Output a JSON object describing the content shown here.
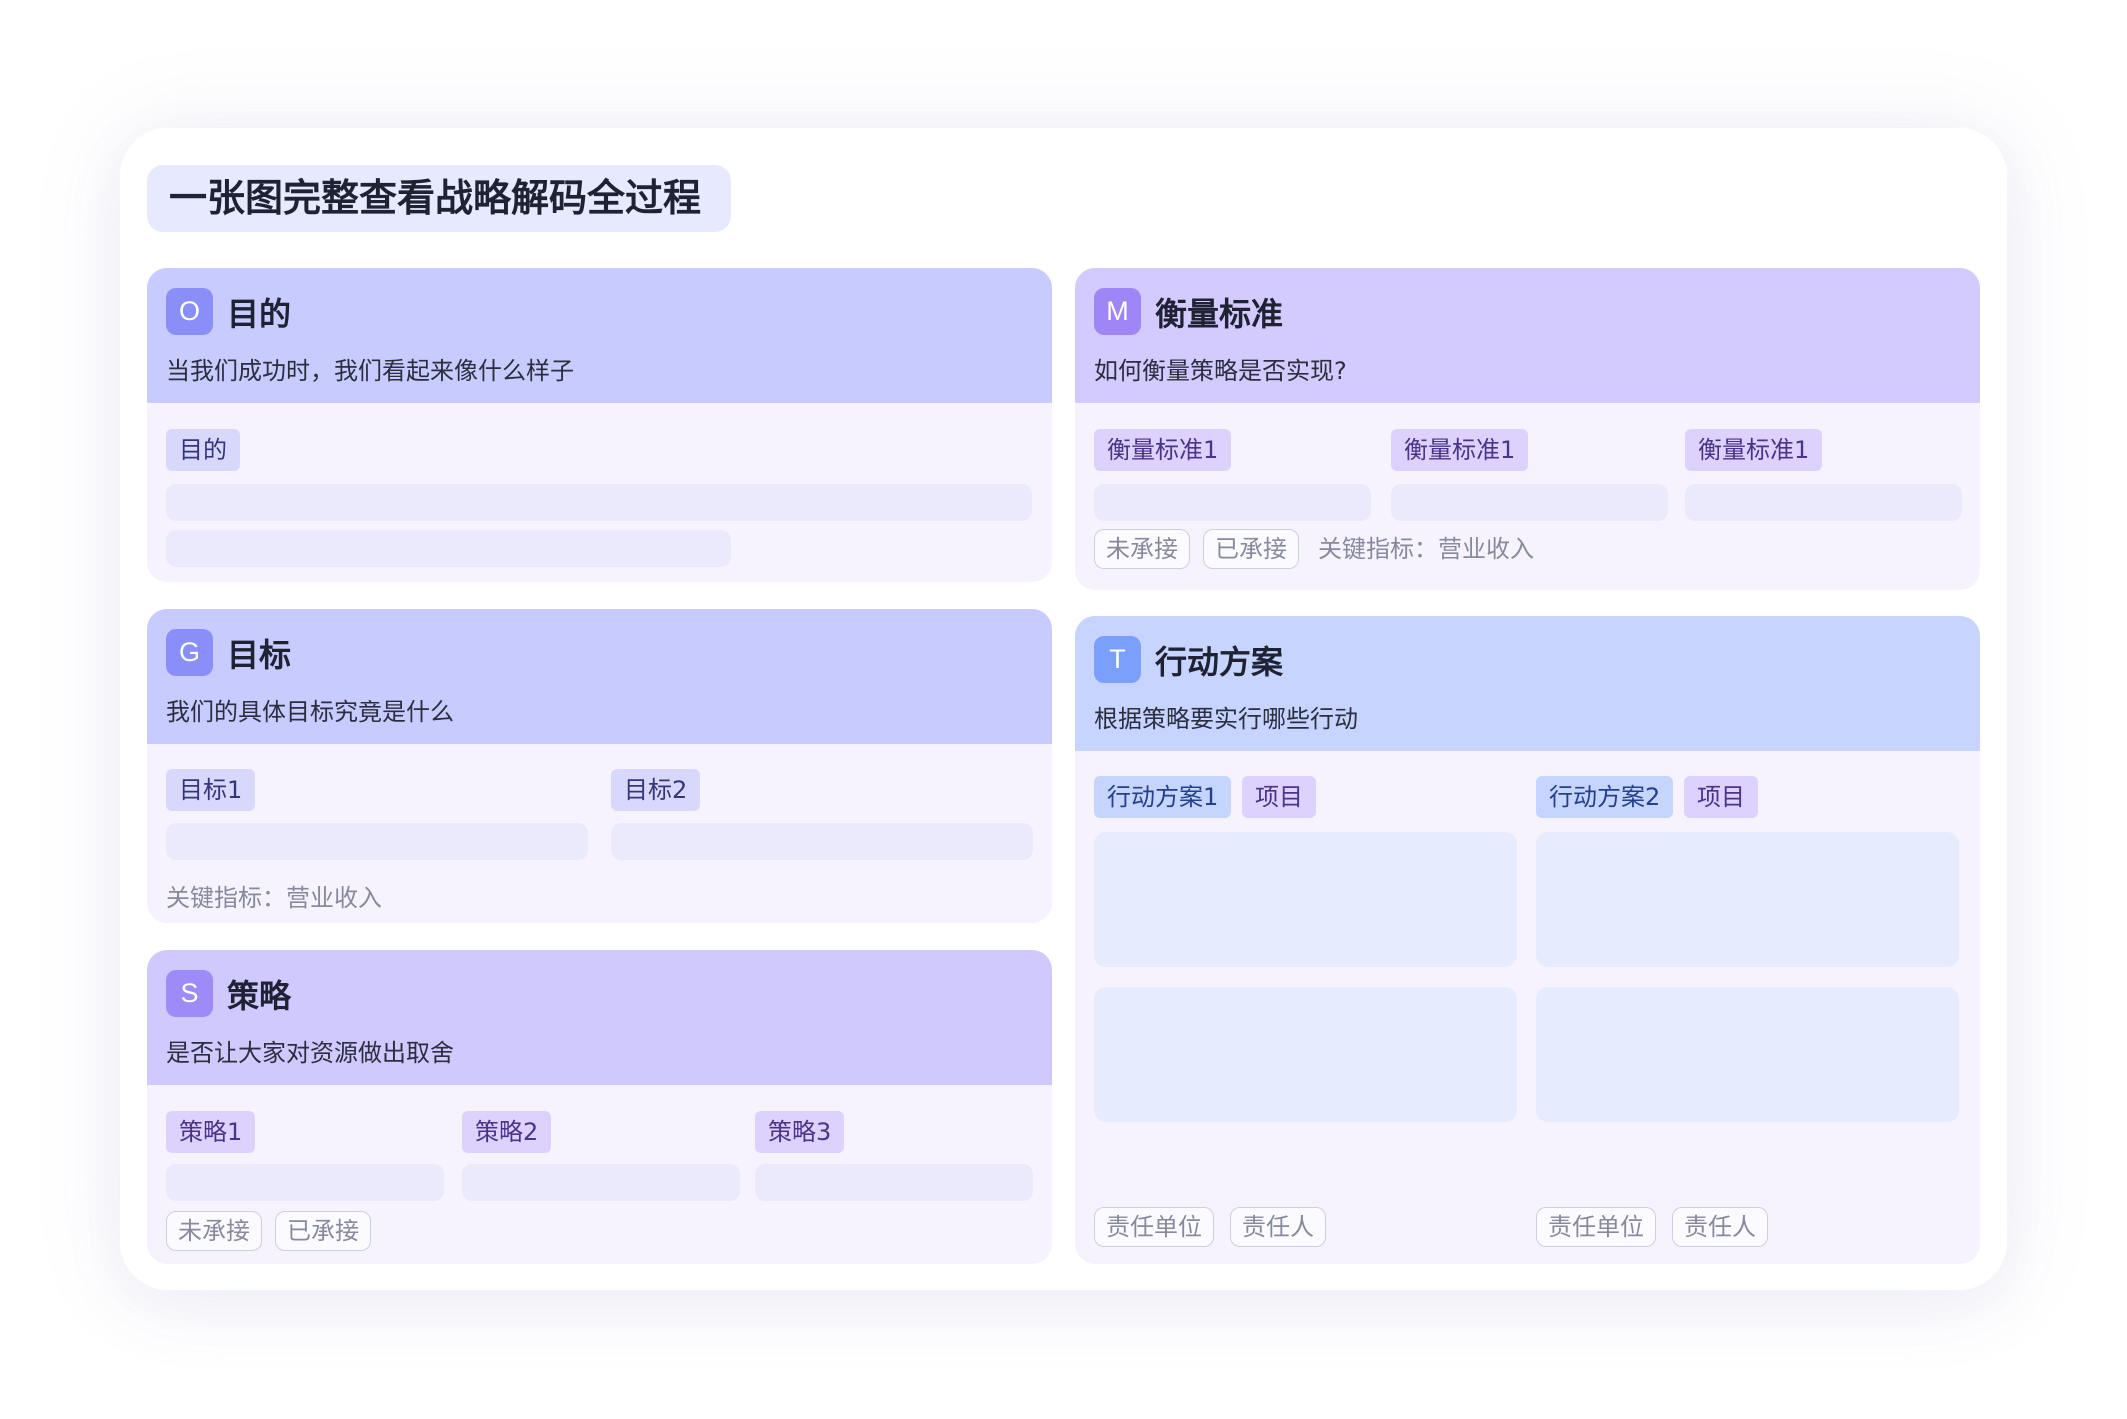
{
  "page": {
    "title": "一张图完整查看战略解码全过程"
  },
  "objective": {
    "letter": "O",
    "title": "目的",
    "subtitle": "当我们成功时，我们看起来像什么样子",
    "tag": "目的"
  },
  "goal": {
    "letter": "G",
    "title": "目标",
    "subtitle": "我们的具体目标究竟是什么",
    "tags": [
      "目标1",
      "目标2"
    ],
    "kpi": "关键指标：营业收入"
  },
  "strategy": {
    "letter": "S",
    "title": "策略",
    "subtitle": "是否让大家对资源做出取舍",
    "tags": [
      "策略1",
      "策略2",
      "策略3"
    ],
    "status": [
      "未承接",
      "已承接"
    ]
  },
  "measure": {
    "letter": "M",
    "title": "衡量标准",
    "subtitle": "如何衡量策略是否实现?",
    "tags": [
      "衡量标准1",
      "衡量标准1",
      "衡量标准1"
    ],
    "status": [
      "未承接",
      "已承接"
    ],
    "kpi": "关键指标：营业收入"
  },
  "tactics": {
    "letter": "T",
    "title": "行动方案",
    "subtitle": "根据策略要实行哪些行动",
    "plans": [
      {
        "name": "行动方案1",
        "type": "项目",
        "owner_unit": "责任单位",
        "owner": "责任人"
      },
      {
        "name": "行动方案2",
        "type": "项目",
        "owner_unit": "责任单位",
        "owner": "责任人"
      }
    ]
  },
  "colors": {
    "header_blue_purple": "#c8cbfe",
    "header_purple": "#d3cafe",
    "header_blue": "#c6d4ff",
    "card_body": "#f6f3ff",
    "title_chip": "#e7eaff"
  }
}
